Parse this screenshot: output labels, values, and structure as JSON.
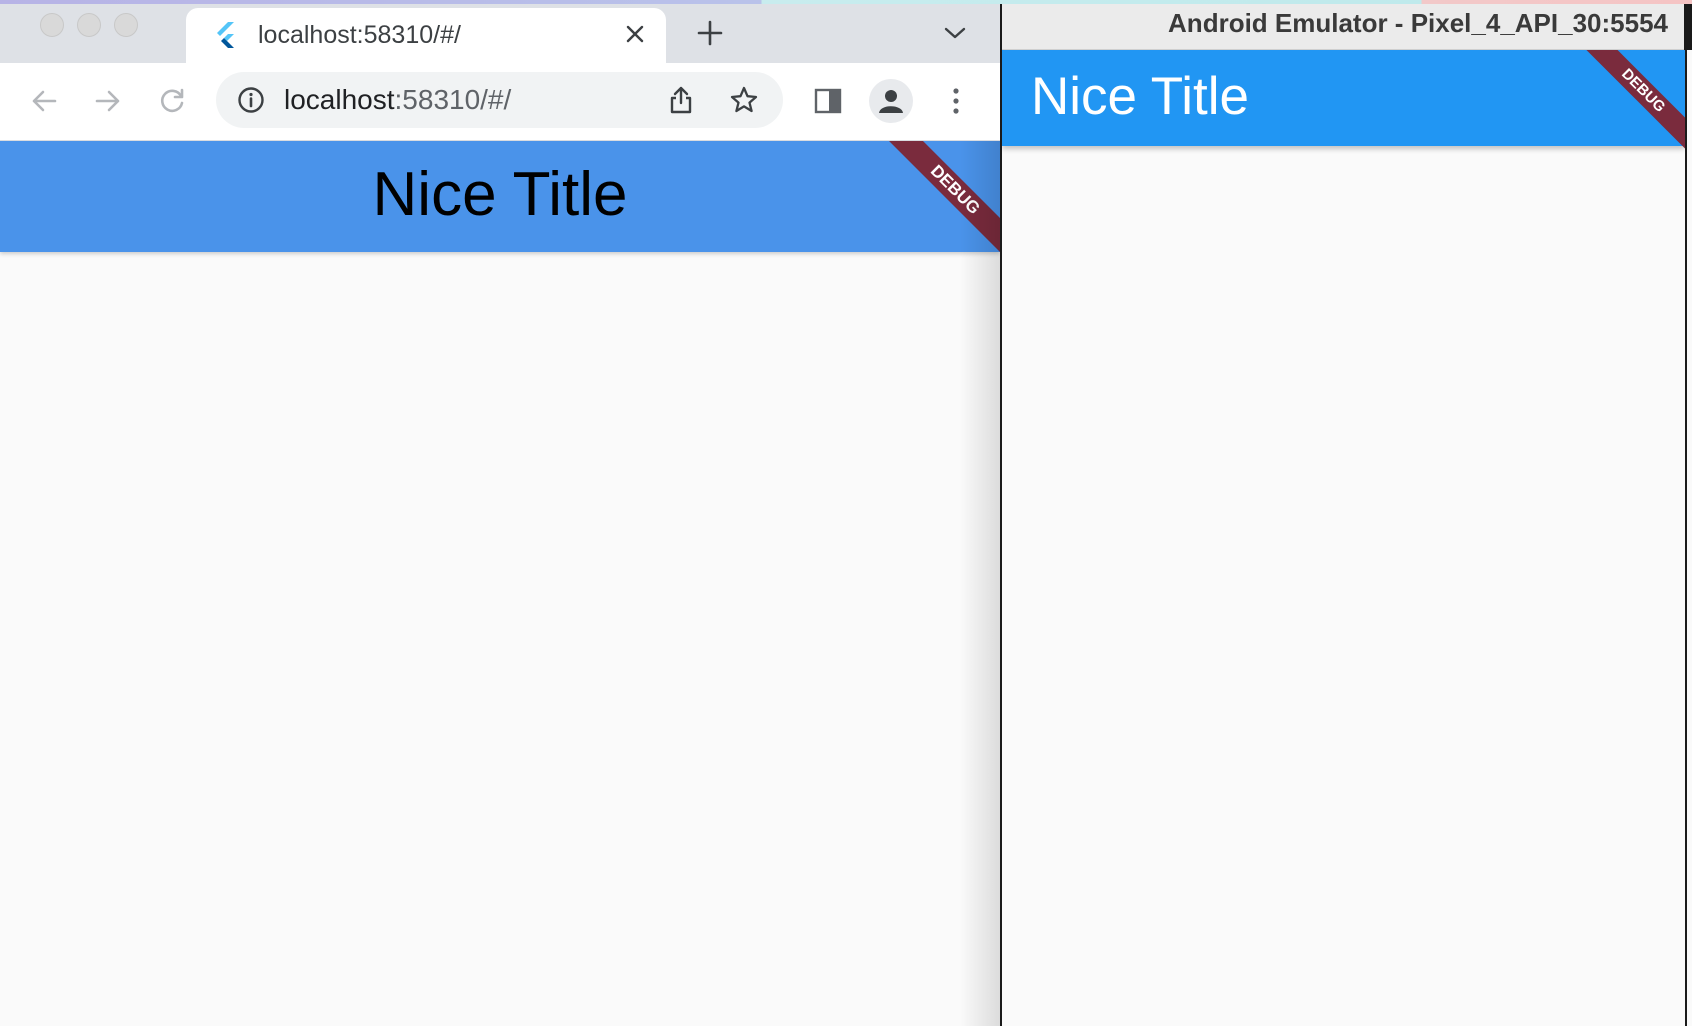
{
  "browser": {
    "tab": {
      "title": "localhost:58310/#/",
      "favicon": "flutter-logo-icon"
    },
    "address": {
      "host": "localhost",
      "rest": ":58310/#/"
    },
    "icons": {
      "close_tab": "close-icon",
      "new_tab": "plus-icon",
      "tab_search": "chevron-down-icon",
      "back": "arrow-left-icon",
      "forward": "arrow-right-icon",
      "reload": "reload-icon",
      "site_info": "info-icon",
      "share": "share-icon",
      "bookmark": "star-icon",
      "side_panel": "side-panel-icon",
      "profile": "person-icon",
      "menu": "more-vert-icon"
    }
  },
  "web_app": {
    "title": "Nice Title",
    "debug_banner": "DEBUG",
    "appbar_color": "#4a93ea",
    "title_color": "#000000"
  },
  "emulator": {
    "window_title": "Android Emulator - Pixel_4_API_30:5554",
    "app": {
      "title": "Nice Title",
      "debug_banner": "DEBUG",
      "appbar_color": "#2196f3",
      "title_color": "#ffffff"
    }
  },
  "colors": {
    "debug_ribbon": "#7a2b3d",
    "background": "#fafafa"
  }
}
